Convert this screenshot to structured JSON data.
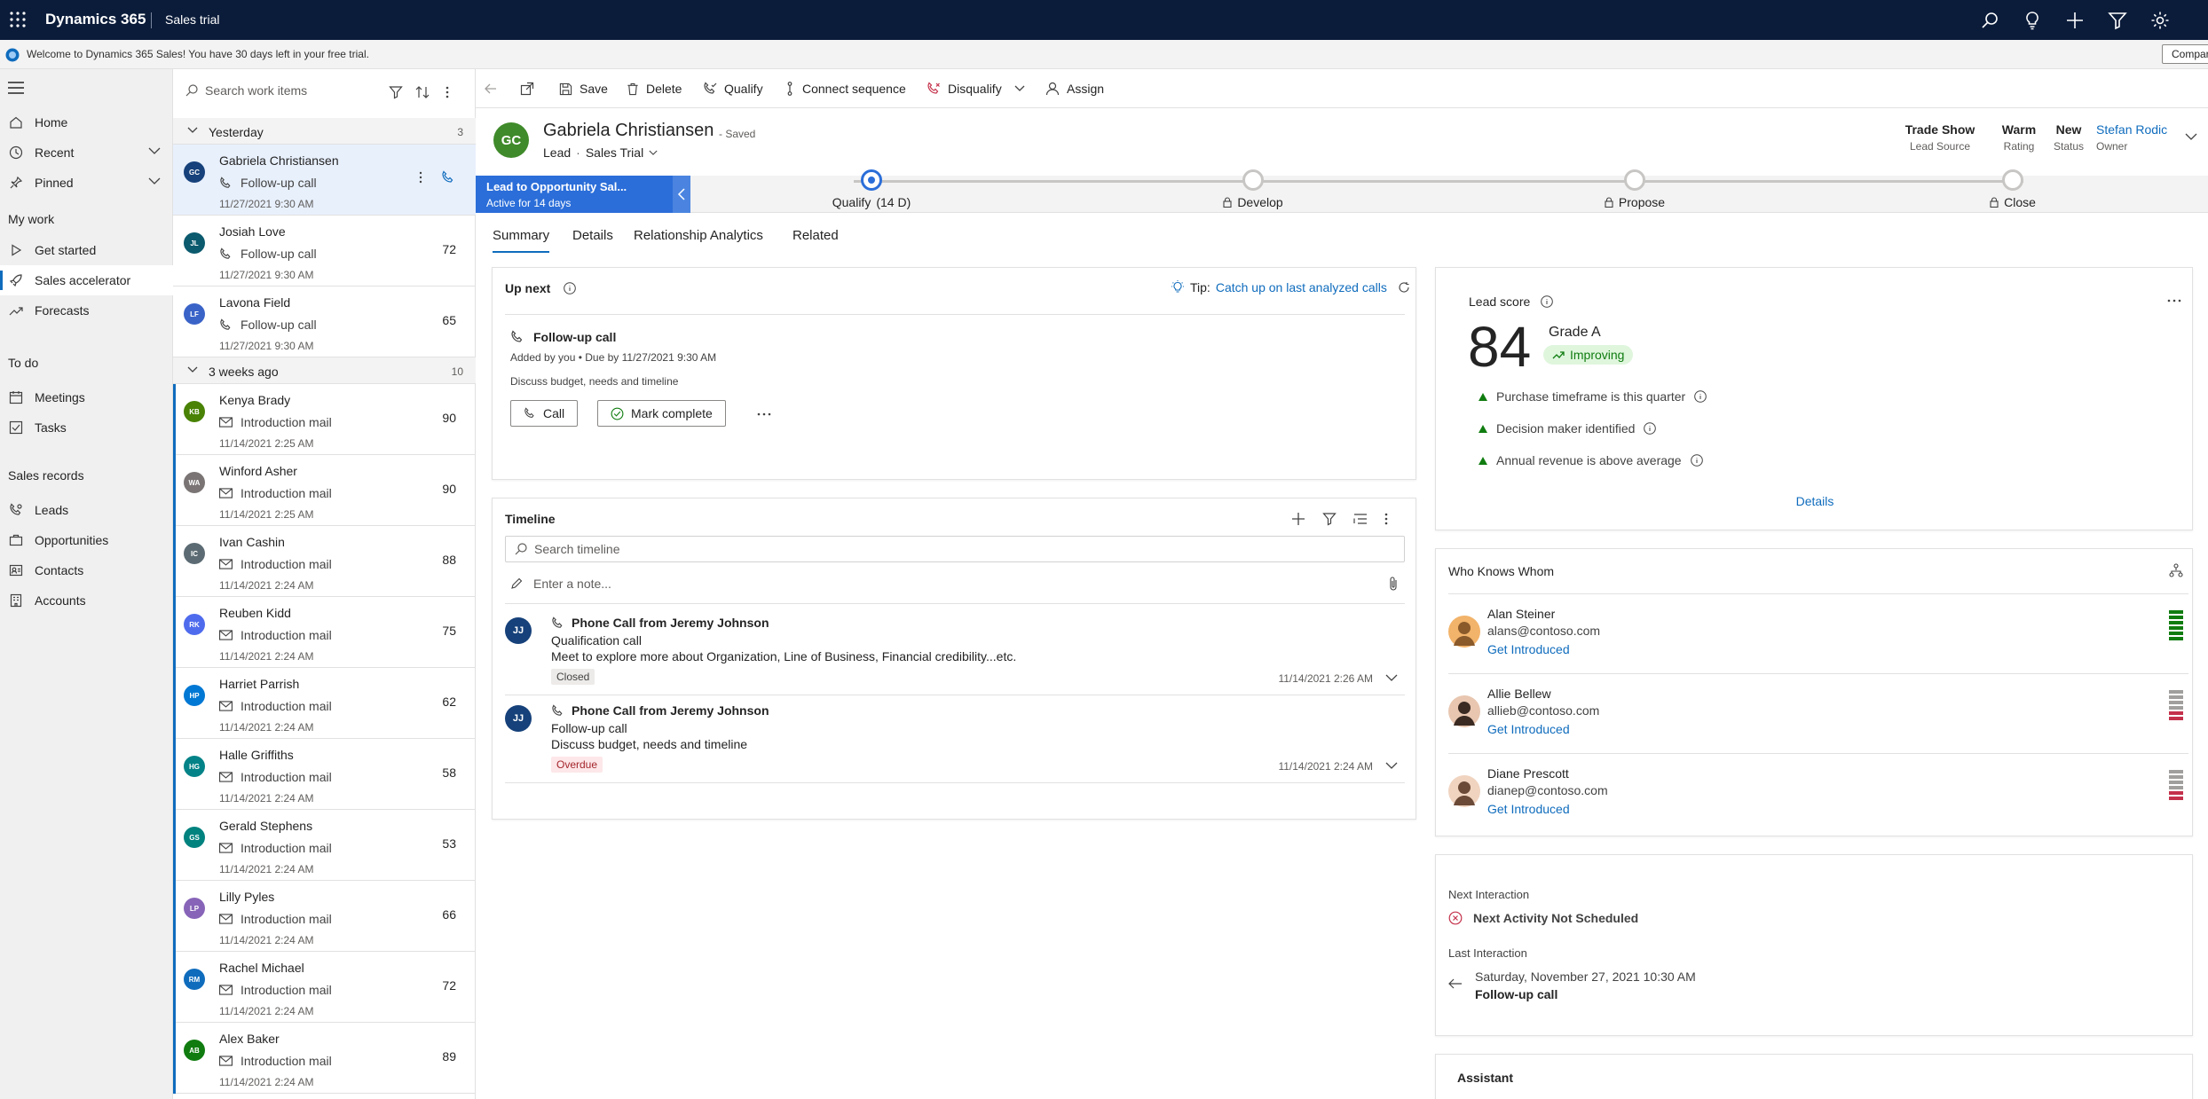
{
  "topbar": {
    "brand": "Dynamics 365",
    "app": "Sales trial",
    "icons": [
      "waffle-icon",
      "search-icon",
      "lightbulb-icon",
      "plus-icon",
      "filter-icon",
      "gear-icon"
    ]
  },
  "banner": {
    "message": "Welcome to Dynamics 365 Sales! You have 30 days left in your free trial.",
    "compare": "Compare"
  },
  "sitemap": {
    "top": [
      {
        "label": "Home",
        "icon": "home-icon"
      },
      {
        "label": "Recent",
        "icon": "clock-icon"
      },
      {
        "label": "Pinned",
        "icon": "pin-icon"
      }
    ],
    "groups": [
      {
        "title": "My work",
        "items": [
          {
            "label": "Get started",
            "icon": "play-icon"
          },
          {
            "label": "Sales accelerator",
            "icon": "rocket-icon"
          },
          {
            "label": "Forecasts",
            "icon": "chart-icon"
          }
        ]
      },
      {
        "title": "To do",
        "items": [
          {
            "label": "Meetings",
            "icon": "calendar-icon"
          },
          {
            "label": "Tasks",
            "icon": "tasks-icon"
          }
        ]
      },
      {
        "title": "Sales records",
        "items": [
          {
            "label": "Leads",
            "icon": "phone-person-icon"
          },
          {
            "label": "Opportunities",
            "icon": "opportunity-icon"
          },
          {
            "label": "Contacts",
            "icon": "contact-icon"
          },
          {
            "label": "Accounts",
            "icon": "account-icon"
          }
        ]
      }
    ]
  },
  "worklist": {
    "search_placeholder": "Search work items",
    "groups": [
      {
        "label": "Yesterday",
        "count": "3"
      },
      {
        "label": "3 weeks ago",
        "count": "10"
      }
    ],
    "items": [
      {
        "initials": "GC",
        "name": "Gabriela Christiansen",
        "activity": "Follow-up call",
        "date": "11/27/2021 9:30 AM",
        "score": "",
        "color": "#16417a",
        "type": "phone"
      },
      {
        "initials": "JL",
        "name": "Josiah Love",
        "activity": "Follow-up call",
        "date": "11/27/2021 9:30 AM",
        "score": "72",
        "color": "#0b5a6e",
        "type": "phone"
      },
      {
        "initials": "LF",
        "name": "Lavona Field",
        "activity": "Follow-up call",
        "date": "11/27/2021 9:30 AM",
        "score": "65",
        "color": "#3a63c8",
        "type": "phone"
      },
      {
        "initials": "KB",
        "name": "Kenya Brady",
        "activity": "Introduction mail",
        "date": "11/14/2021 2:25 AM",
        "score": "90",
        "color": "#498205",
        "type": "mail"
      },
      {
        "initials": "WA",
        "name": "Winford Asher",
        "activity": "Introduction mail",
        "date": "11/14/2021 2:25 AM",
        "score": "90",
        "color": "#7a7574",
        "type": "mail"
      },
      {
        "initials": "IC",
        "name": "Ivan Cashin",
        "activity": "Introduction mail",
        "date": "11/14/2021 2:24 AM",
        "score": "88",
        "color": "#5c6b73",
        "type": "mail"
      },
      {
        "initials": "RK",
        "name": "Reuben Kidd",
        "activity": "Introduction mail",
        "date": "11/14/2021 2:24 AM",
        "score": "75",
        "color": "#4f6bed",
        "type": "mail"
      },
      {
        "initials": "HP",
        "name": "Harriet Parrish",
        "activity": "Introduction mail",
        "date": "11/14/2021 2:24 AM",
        "score": "62",
        "color": "#0078d4",
        "type": "mail"
      },
      {
        "initials": "HG",
        "name": "Halle Griffiths",
        "activity": "Introduction mail",
        "date": "11/14/2021 2:24 AM",
        "score": "58",
        "color": "#038387",
        "type": "mail"
      },
      {
        "initials": "GS",
        "name": "Gerald Stephens",
        "activity": "Introduction mail",
        "date": "11/14/2021 2:24 AM",
        "score": "53",
        "color": "#00827f",
        "type": "mail"
      },
      {
        "initials": "LP",
        "name": "Lilly Pyles",
        "activity": "Introduction mail",
        "date": "11/14/2021 2:24 AM",
        "score": "66",
        "color": "#8764b8",
        "type": "mail"
      },
      {
        "initials": "RM",
        "name": "Rachel Michael",
        "activity": "Introduction mail",
        "date": "11/14/2021 2:24 AM",
        "score": "72",
        "color": "#0f6cbd",
        "type": "mail"
      },
      {
        "initials": "AB",
        "name": "Alex Baker",
        "activity": "Introduction mail",
        "date": "11/14/2021 2:24 AM",
        "score": "89",
        "color": "#107c10",
        "type": "mail"
      }
    ]
  },
  "commands": {
    "save": "Save",
    "delete": "Delete",
    "qualify": "Qualify",
    "connect_sequence": "Connect sequence",
    "disqualify": "Disqualify",
    "assign": "Assign"
  },
  "record": {
    "initials": "GC",
    "name": "Gabriela Christiansen",
    "saved": "- Saved",
    "entity": "Lead",
    "form": "Sales Trial",
    "fields": [
      {
        "value": "Trade Show",
        "label": "Lead Source"
      },
      {
        "value": "Warm",
        "label": "Rating"
      },
      {
        "value": "New",
        "label": "Status"
      },
      {
        "value": "Stefan Rodic",
        "label": "Owner"
      }
    ]
  },
  "bpf": {
    "title": "Lead to Opportunity Sal...",
    "subtitle": "Active for 14 days",
    "stages": [
      {
        "label": "Qualify",
        "extra": "(14 D)"
      },
      {
        "label": "Develop"
      },
      {
        "label": "Propose"
      },
      {
        "label": "Close"
      }
    ]
  },
  "tabs": [
    "Summary",
    "Details",
    "Relationship Analytics",
    "Related"
  ],
  "upnext": {
    "title": "Up next",
    "tip_label": "Tip:",
    "tip_link": "Catch up on last analyzed calls",
    "activity": "Follow-up call",
    "meta": "Added by you • Due by 11/27/2021 9:30 AM",
    "desc": "Discuss budget, needs and timeline",
    "call": "Call",
    "mark_complete": "Mark complete"
  },
  "timeline": {
    "title": "Timeline",
    "search_placeholder": "Search timeline",
    "note_placeholder": "Enter a note...",
    "items": [
      {
        "initials": "JJ",
        "title": "Phone Call from Jeremy Johnson",
        "line1": "Qualification call",
        "line2": "Meet to explore more about Organization, Line of Business, Financial credibility...etc.",
        "badge": "Closed",
        "time": "11/14/2021 2:26 AM"
      },
      {
        "initials": "JJ",
        "title": "Phone Call from Jeremy Johnson",
        "line1": "Follow-up call",
        "line2": "Discuss budget, needs and timeline",
        "badge": "Overdue",
        "time": "11/14/2021 2:24 AM"
      }
    ]
  },
  "leadscore": {
    "title": "Lead score",
    "score": "84",
    "grade": "Grade A",
    "trend": "Improving",
    "criteria": [
      "Purchase timeframe is this quarter",
      "Decision maker identified",
      "Annual revenue is above average"
    ],
    "details": "Details"
  },
  "whoknows": {
    "title": "Who Knows Whom",
    "people": [
      {
        "name": "Alan Steiner",
        "email": "alans@contoso.com",
        "action": "Get Introduced",
        "strength": "strong"
      },
      {
        "name": "Allie Bellew",
        "email": "allieb@contoso.com",
        "action": "Get Introduced",
        "strength": "weak"
      },
      {
        "name": "Diane Prescott",
        "email": "dianep@contoso.com",
        "action": "Get Introduced",
        "strength": "weak"
      }
    ]
  },
  "interaction": {
    "next_label": "Next Interaction",
    "next_value": "Next Activity Not Scheduled",
    "last_label": "Last Interaction",
    "last_date": "Saturday, November 27, 2021 10:30 AM",
    "last_activity": "Follow-up call"
  },
  "assistant": {
    "title": "Assistant"
  }
}
